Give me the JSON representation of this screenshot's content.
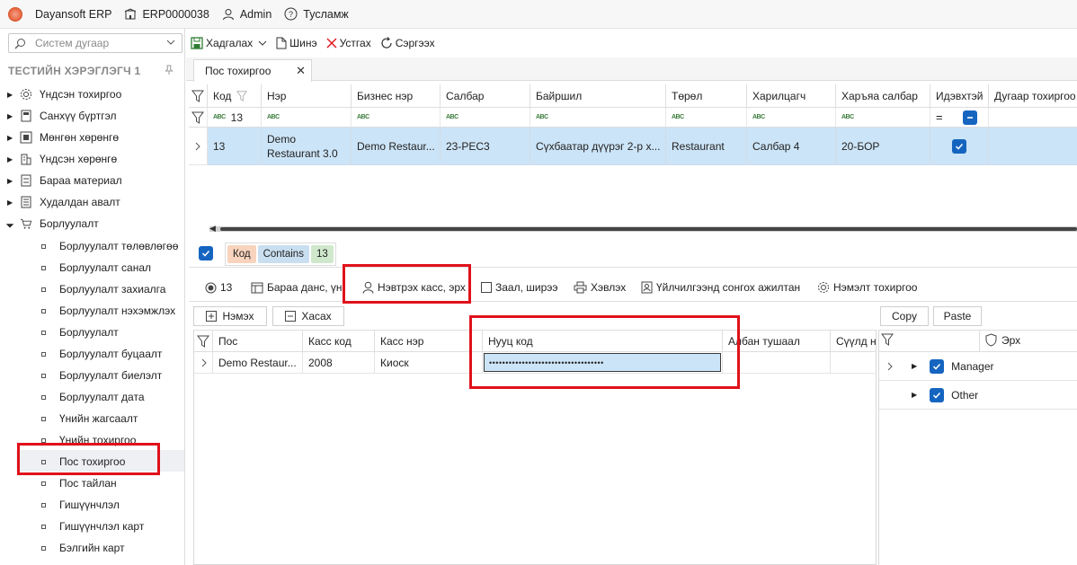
{
  "app": {
    "name": "Dayansoft ERP",
    "company": "ERP0000038",
    "user": "Admin",
    "help": "Тусламж"
  },
  "sidebar": {
    "search_placeholder": "Систем дугаар",
    "user_header": "ТЕСТИЙН ХЭРЭГЛЭГЧ 1",
    "modules": [
      {
        "label": "Үндсэн тохиргоо",
        "icon": "gear-icon"
      },
      {
        "label": "Санхүү бүртгэл",
        "icon": "ledger-icon"
      },
      {
        "label": "Мөнгөн хөрөнгө",
        "icon": "cash-icon"
      },
      {
        "label": "Үндсэн хөрөнгө",
        "icon": "building-icon"
      },
      {
        "label": "Бараа материал",
        "icon": "inventory-icon"
      },
      {
        "label": "Худалдан авалт",
        "icon": "purchase-icon"
      },
      {
        "label": "Борлуулалт",
        "icon": "cart-icon"
      }
    ],
    "sales_items": [
      "Борлуулалт төлөвлөгөө",
      "Борлуулалт санал",
      "Борлуулалт захиалга",
      "Борлуулалт нэхэмжлэх",
      "Борлуулалт",
      "Борлуулалт буцаалт",
      "Борлуулалт биелэлт",
      "Борлуулалт дата",
      "Үнийн жагсаалт",
      "Үнийн тохиргоо",
      "Пос тохиргоо",
      "Пос тайлан",
      "Гишүүнчлэл",
      "Гишүүнчлэл карт",
      "Бэлгийн карт"
    ],
    "selected_item": "Пос тохиргоо"
  },
  "toolbar": {
    "save": "Хадгалах",
    "new": "Шинэ",
    "delete": "Устгах",
    "refresh": "Сэргээх"
  },
  "tab": {
    "label": "Пос тохиргоо"
  },
  "main_grid": {
    "columns": [
      "Код",
      "Нэр",
      "Бизнес нэр",
      "Салбар",
      "Байршил",
      "Төрөл",
      "Харилцагч",
      "Харъяа салбар",
      "Идэвхтэй",
      "Дугаар тохиргоо"
    ],
    "filter_code_value": "13",
    "row": {
      "code": "13",
      "name_line1": "Demo",
      "name_line2": "Restaurant 3.0",
      "business_name": "Demo Restaur...",
      "branch": "23-РЕС3",
      "location": "Сүхбаатар дүүрэг 2-р х...",
      "type": "Restaurant",
      "customer": "Салбар 4",
      "parent_branch": "20-БОР",
      "active": true
    }
  },
  "filter_panel": {
    "field": "Код",
    "op": "Contains",
    "value": "13"
  },
  "subtabs": {
    "code": "13",
    "items": [
      "Бараа данс, үнэ",
      "Нэвтрэх касс, эрх",
      "Заал, ширээ",
      "Хэвлэх",
      "Үйлчилгээнд сонгох ажилтан",
      "Нэмэлт тохиргоо"
    ],
    "active": "Нэвтрэх касс, эрх"
  },
  "cashier_panel": {
    "add": "Нэмэх",
    "remove": "Хасах",
    "columns": [
      "Пос",
      "Касс код",
      "Касс нэр",
      "Нууц код",
      "Албан тушаал",
      "Сүүлд нэ"
    ],
    "row": {
      "pos": "Demo Restaur...",
      "cashier_code": "2008",
      "cashier_name": "Киоск",
      "password": "•••••••••••••••••••••••••••••••••••",
      "position": "",
      "last": ""
    }
  },
  "rights_panel": {
    "copy": "Copy",
    "paste": "Paste",
    "column": "Эрх",
    "rows": [
      {
        "label": "Manager",
        "checked": true
      },
      {
        "label": "Other",
        "checked": true
      }
    ]
  },
  "colors": {
    "highlight_red": "#e0111b",
    "selection_blue": "#cce4f7",
    "checkbox_blue": "#1565c0",
    "chip_orange": "#f8d3bd",
    "chip_blue": "#c9dff0",
    "chip_green": "#cfe8cc"
  }
}
